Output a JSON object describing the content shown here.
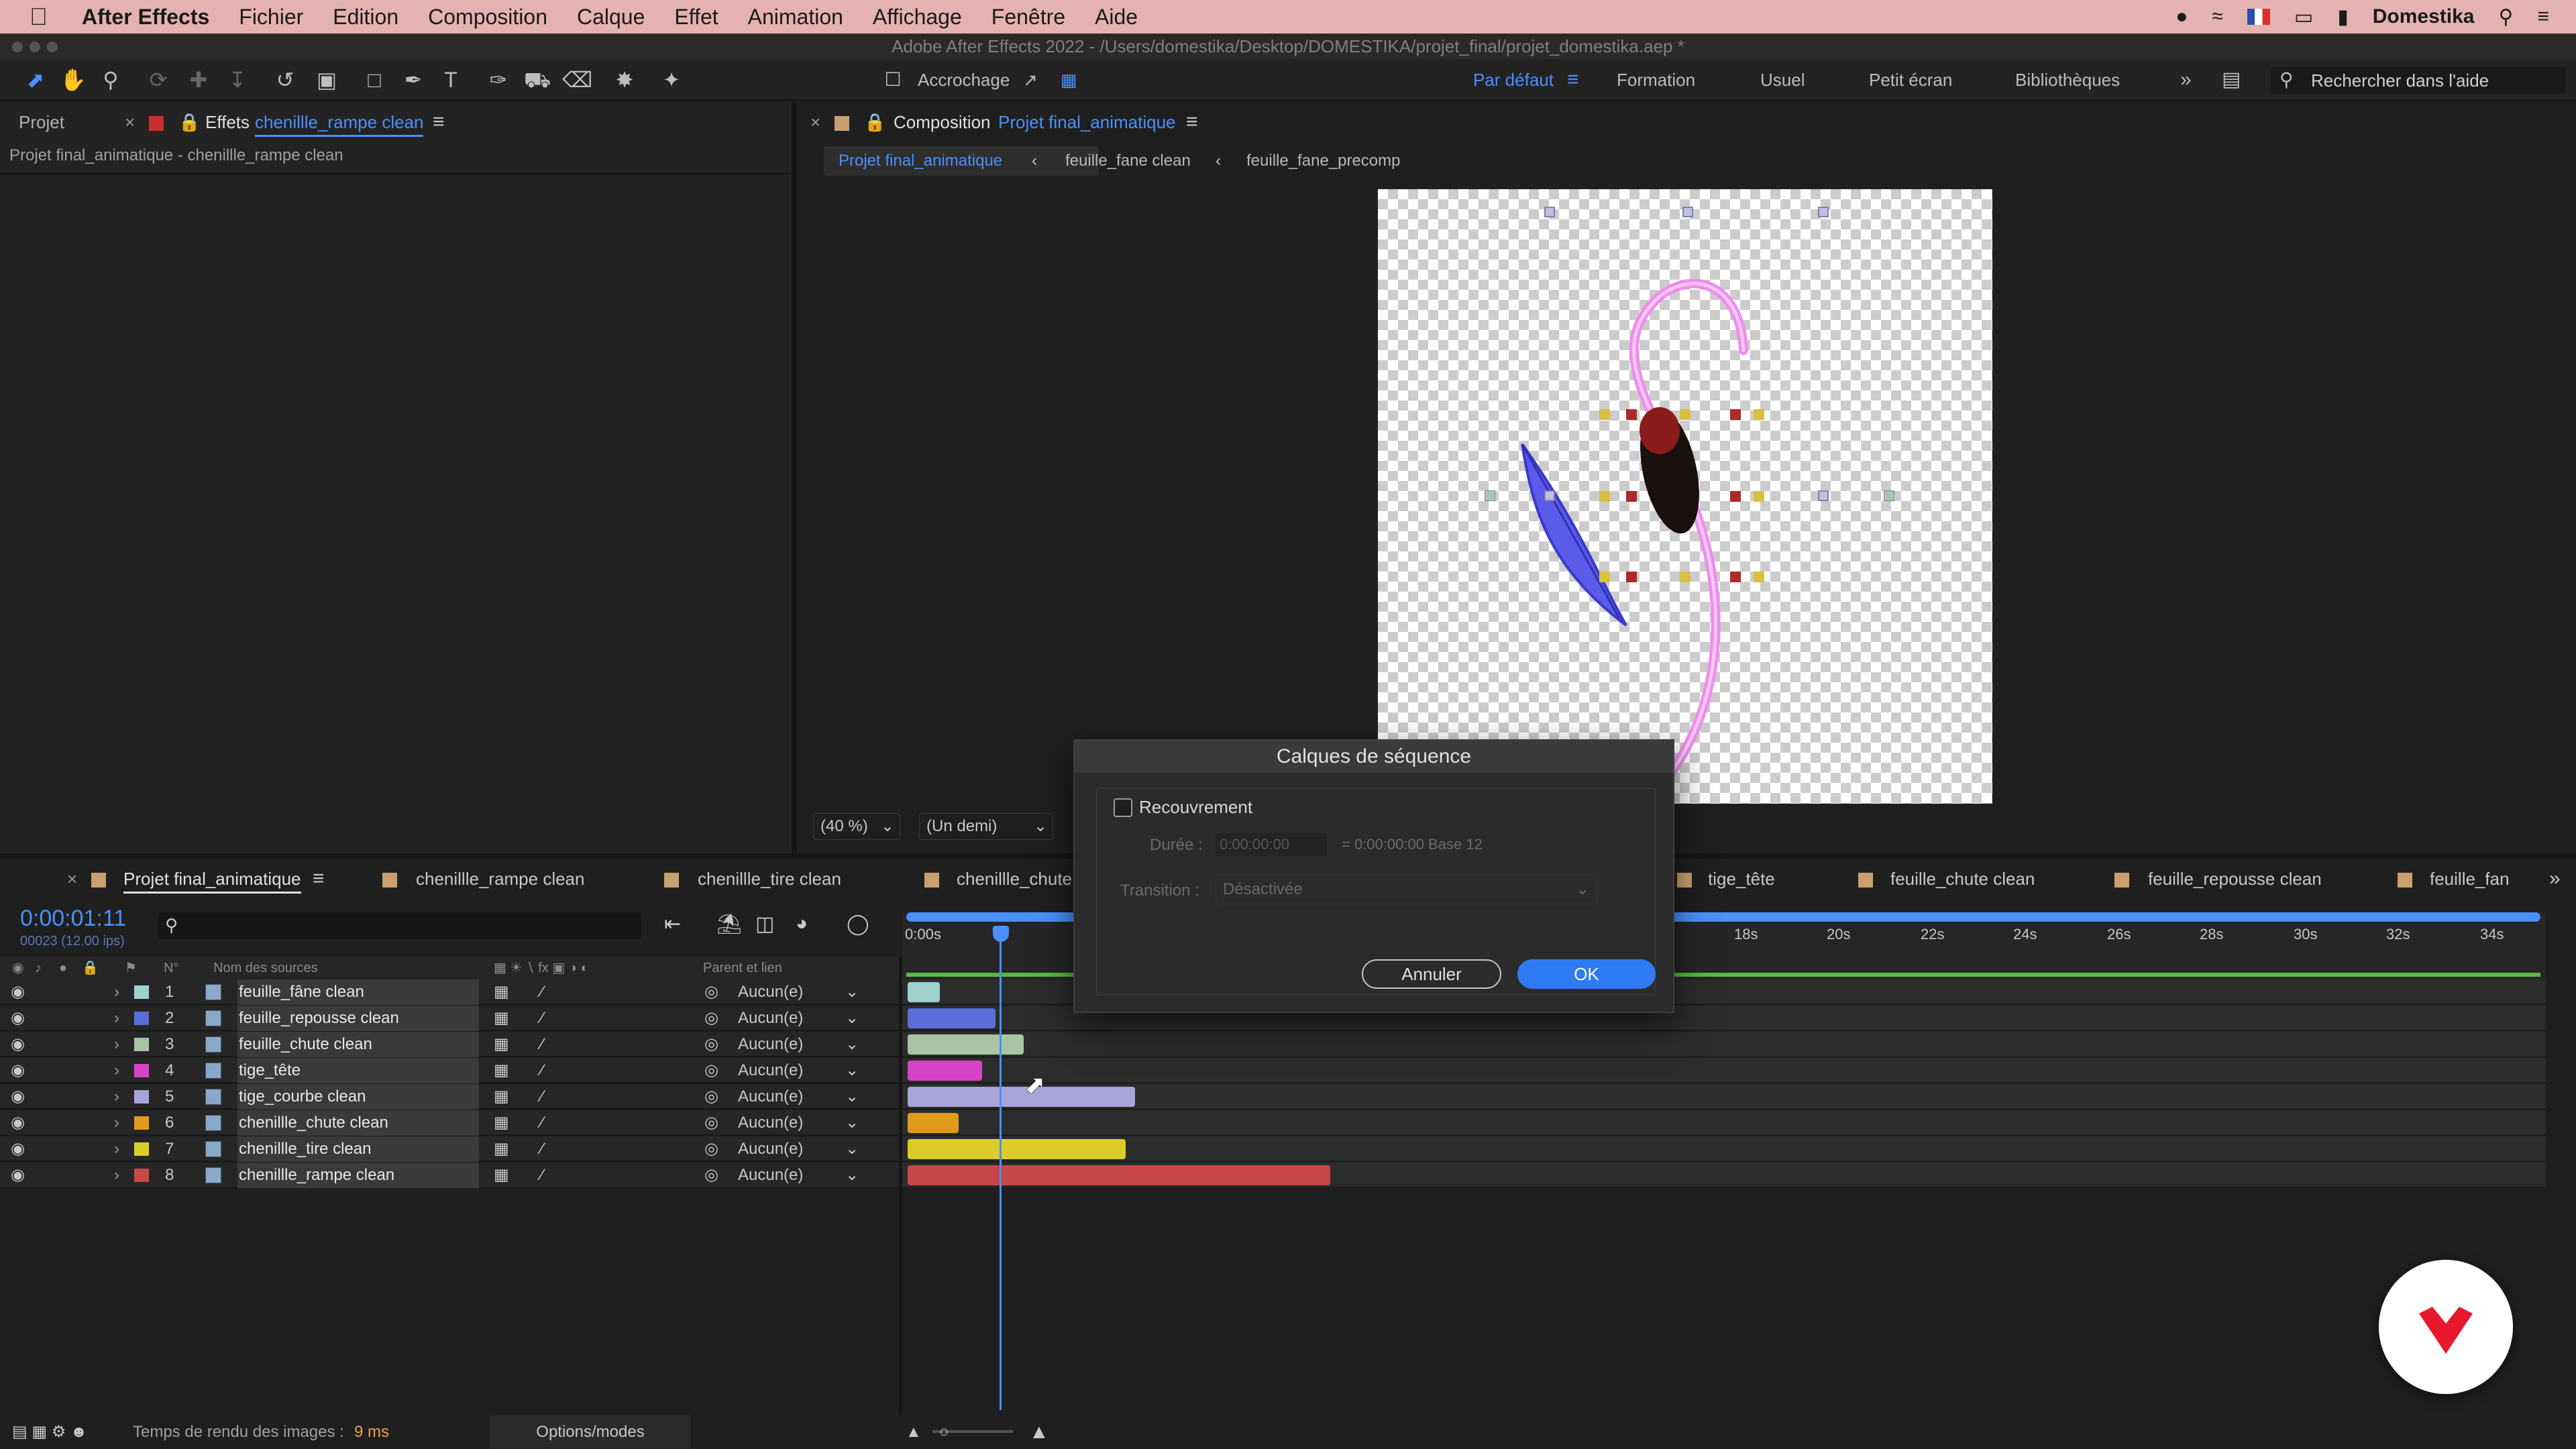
{
  "menubar": {
    "app": "After Effects",
    "items": [
      "Fichier",
      "Edition",
      "Composition",
      "Calque",
      "Effet",
      "Animation",
      "Affichage",
      "Fenêtre",
      "Aide"
    ],
    "right_label": "Domestika"
  },
  "window": {
    "title": "Adobe After Effects 2022 - /Users/domestika/Desktop/DOMESTIKA/projet_final/projet_domestika.aep *"
  },
  "toolbar": {
    "snapping_label": "Accrochage",
    "workspaces": [
      "Par défaut",
      "Formation",
      "Usuel",
      "Petit écran",
      "Bibliothèques"
    ],
    "active_workspace": "Par défaut",
    "search_placeholder": "Rechercher dans l'aide"
  },
  "left_panel": {
    "tab_project": "Projet",
    "tab_effects_prefix": "Effets",
    "tab_effects_name": "chenillle_rampe clean",
    "path": "Projet final_animatique - chenillle_rampe clean"
  },
  "viewer": {
    "tab_label": "Composition",
    "tab_name": "Projet final_animatique",
    "breadcrumbs": [
      "Projet final_animatique",
      "feuille_fane clean",
      "feuille_fane_precomp"
    ],
    "zoom": "(40 %)",
    "resolution": "(Un demi)"
  },
  "timeline": {
    "tabs": [
      "Projet final_animatique",
      "chenillle_rampe clean",
      "chenillle_tire clean",
      "chenillle_chute",
      "tige_tête",
      "feuille_chute clean",
      "feuille_repousse clean",
      "feuille_fan"
    ],
    "timecode": "0:00:01:11",
    "frame_info": "00023 (12.00 ips)",
    "col_num": "N°",
    "col_source": "Nom des sources",
    "col_parent": "Parent et lien",
    "ruler": [
      "0:00s",
      "18s",
      "20s",
      "22s",
      "24s",
      "26s",
      "28s",
      "30s",
      "32s",
      "34s"
    ],
    "layers": [
      {
        "num": "1",
        "name": "feuille_fâne clean",
        "parent": "Aucun(e)",
        "color": "#9fd2cf",
        "start": 0.0,
        "end": 0.7
      },
      {
        "num": "2",
        "name": "feuille_repousse clean",
        "parent": "Aucun(e)",
        "color": "#5a6fd8",
        "start": 0.0,
        "end": 1.9
      },
      {
        "num": "3",
        "name": "feuille_chute clean",
        "parent": "Aucun(e)",
        "color": "#a8c4a4",
        "start": 0.0,
        "end": 2.5
      },
      {
        "num": "4",
        "name": "tige_tête",
        "parent": "Aucun(e)",
        "color": "#d844c8",
        "start": 0.0,
        "end": 1.6
      },
      {
        "num": "5",
        "name": "tige_courbe clean",
        "parent": "Aucun(e)",
        "color": "#a8a4d8",
        "start": 0.0,
        "end": 4.9
      },
      {
        "num": "6",
        "name": "chenillle_chute clean",
        "parent": "Aucun(e)",
        "color": "#e09a1c",
        "start": 0.0,
        "end": 1.1
      },
      {
        "num": "7",
        "name": "chenillle_tire clean",
        "parent": "Aucun(e)",
        "color": "#dccc28",
        "start": 0.0,
        "end": 4.7
      },
      {
        "num": "8",
        "name": "chenillle_rampe clean",
        "parent": "Aucun(e)",
        "color": "#c84848",
        "start": 0.0,
        "end": 9.1
      }
    ]
  },
  "dialog": {
    "title": "Calques de séquence",
    "overlap_label": "Recouvrement",
    "duration_label": "Durée :",
    "duration_value": "0:00:00:00",
    "duration_info": "= 0:00:00:00  Base 12",
    "transition_label": "Transition :",
    "transition_value": "Désactivée",
    "cancel_label": "Annuler",
    "ok_label": "OK"
  },
  "statusbar": {
    "render_label": "Temps de rendu des images :",
    "render_value": "9 ms",
    "options_label": "Options/modes"
  },
  "colors": {
    "accent": "#4a90ff",
    "menubar": "#e4b2b0",
    "panel": "#232323",
    "brand": "#e8192c"
  }
}
